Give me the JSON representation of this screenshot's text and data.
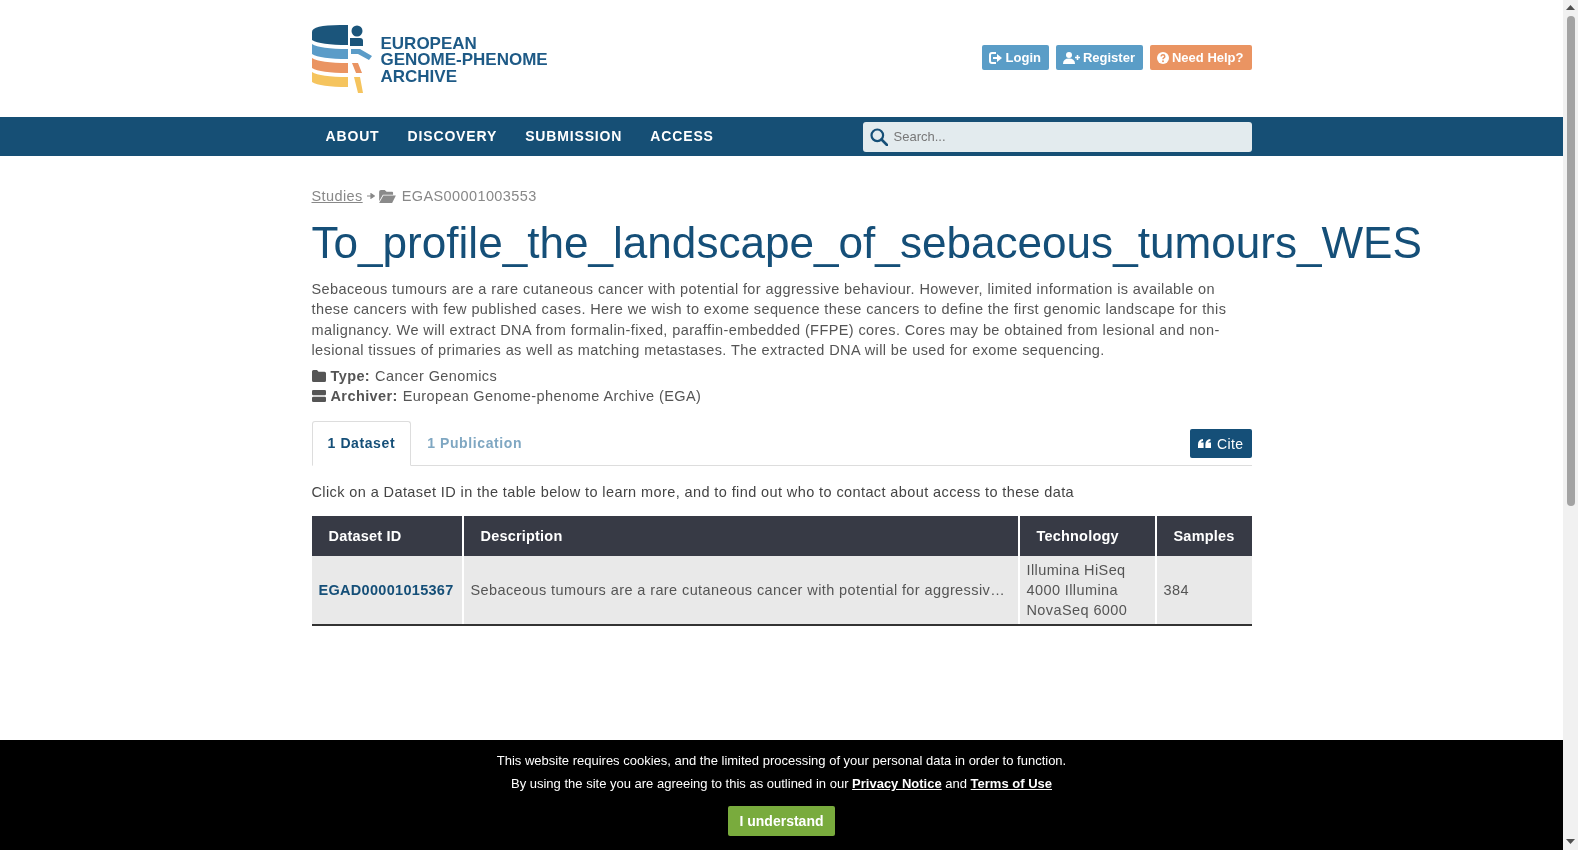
{
  "header": {
    "logo": {
      "lines": [
        "EUROPEAN",
        "GENOME-PHENOME",
        "ARCHIVE"
      ]
    },
    "buttons": [
      {
        "label": "Login",
        "kind": "login"
      },
      {
        "label": "Register",
        "kind": "register"
      },
      {
        "label": "Need Help?",
        "kind": "help"
      }
    ]
  },
  "nav": {
    "items": [
      {
        "label": "ABOUT"
      },
      {
        "label": "DISCOVERY"
      },
      {
        "label": "SUBMISSION"
      },
      {
        "label": "ACCESS"
      }
    ],
    "search": {
      "placeholder": "Search..."
    }
  },
  "breadcrumb": {
    "link": "Studies",
    "current": "EGAS00001003553"
  },
  "study": {
    "title": "To_profile_the_landscape_of_sebaceous_tumours_WES",
    "description": "Sebaceous tumours are a rare cutaneous cancer with potential for aggressive behaviour. However, limited information is available on these cancers with few published cases. Here we wish to exome sequence these cancers to define the first genomic landscape for this malignancy. We will extract DNA from formalin-fixed, paraffin-embedded (FFPE) cores. Cores may be obtained from lesional and non-lesional tissues of primaries as well as matching metastases. The extracted DNA will be used for exome sequencing.",
    "meta": [
      {
        "kind": "type",
        "label": "Type:",
        "value": "Cancer Genomics"
      },
      {
        "kind": "archiver",
        "label": "Archiver:",
        "value": "European Genome-phenome Archive (EGA)"
      }
    ]
  },
  "tabs": [
    {
      "label": "1 Dataset",
      "selected": true
    },
    {
      "label": "1 Publication",
      "selected": false
    }
  ],
  "cite_button": {
    "label": "Cite"
  },
  "instruction": "Click on a Dataset ID in the table below to learn more, and to find out who to contact about access to these data",
  "table": {
    "columns": [
      "Dataset ID",
      "Description",
      "Technology",
      "Samples"
    ],
    "rows": [
      {
        "dataset_id": "EGAD00001015367",
        "description": "Sebaceous tumours are a rare cutaneous cancer with potential for aggressiv…",
        "technology": "Illumina HiSeq 4000 Illumina NovaSeq 6000",
        "samples": "384"
      }
    ]
  },
  "cookie_banner": {
    "message": "This website requires cookies, and the limited processing of your personal data in order to function.",
    "consent": {
      "text": "By using the site you are agreeing to this as outlined in our",
      "privacy_link": "Privacy Notice",
      "joiner": "and",
      "terms_link": "Terms of Use"
    },
    "button": "I understand"
  }
}
